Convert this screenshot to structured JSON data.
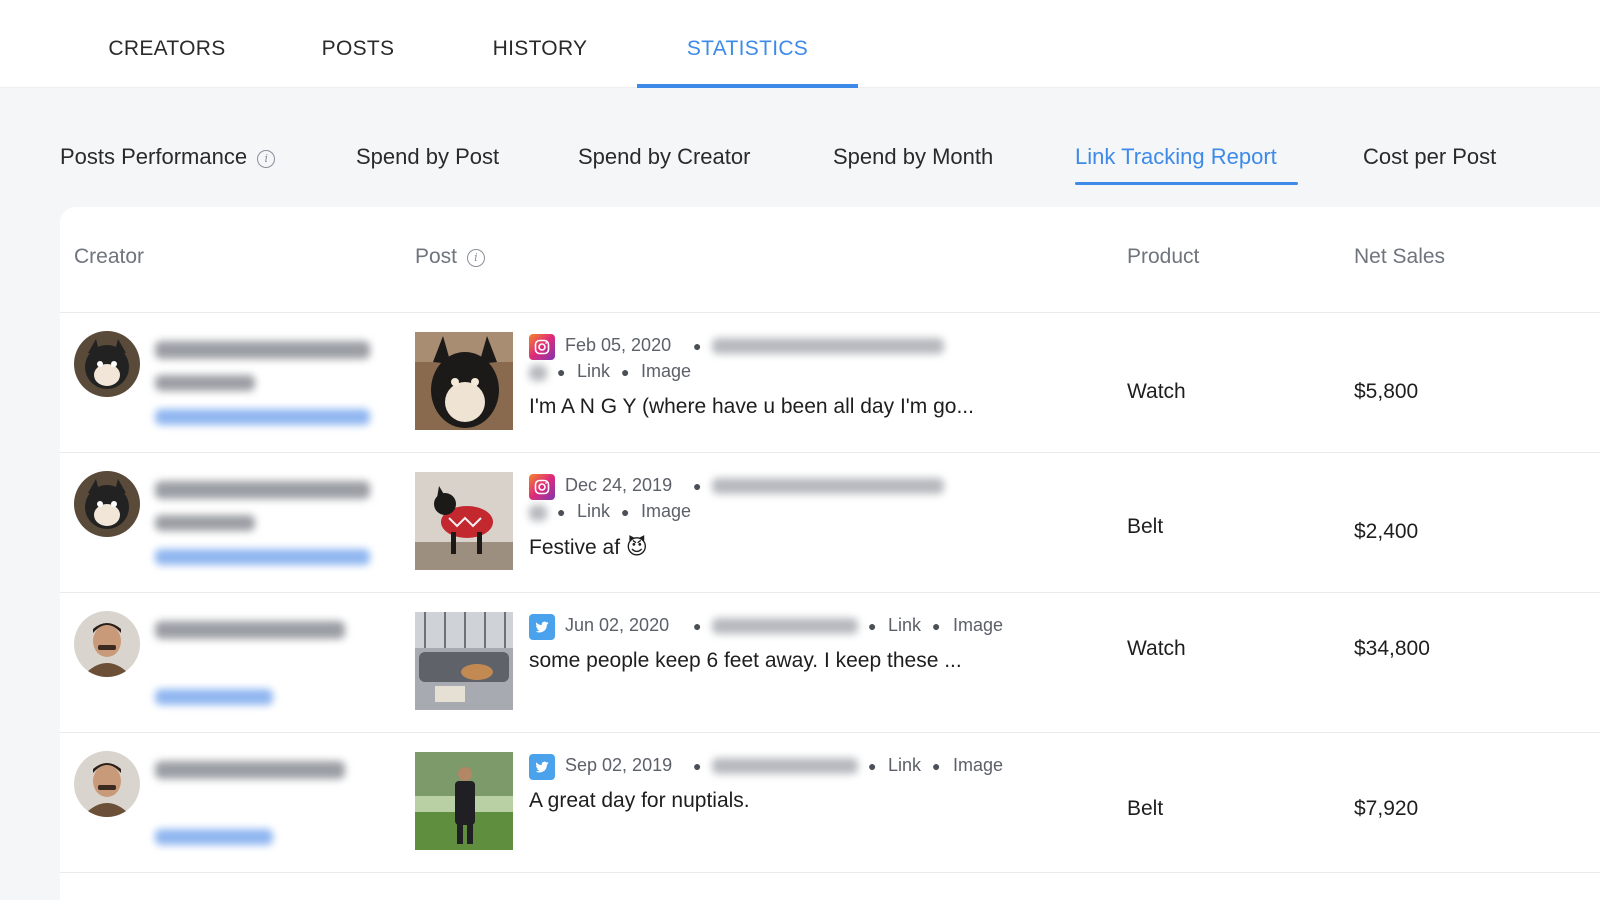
{
  "topnav": {
    "tabs": [
      {
        "label": "CREATORS"
      },
      {
        "label": "POSTS"
      },
      {
        "label": "HISTORY"
      },
      {
        "label": "STATISTICS"
      }
    ],
    "active": "STATISTICS"
  },
  "subtabs": {
    "items": [
      {
        "label": "Posts Performance"
      },
      {
        "label": "Spend by Post"
      },
      {
        "label": "Spend by Creator"
      },
      {
        "label": "Spend by Month"
      },
      {
        "label": "Link Tracking Report"
      },
      {
        "label": "Cost per Post"
      }
    ],
    "active": "Link Tracking Report"
  },
  "table": {
    "headers": {
      "creator": "Creator",
      "post": "Post",
      "product": "Product",
      "net_sales": "Net Sales"
    },
    "rows": [
      {
        "platform": "instagram-icon",
        "date": "Feb 05, 2020",
        "link_label": "Link",
        "media_label": "Image",
        "caption": "I'm A N G Y (where have u been all day I'm go...",
        "product": "Watch",
        "net_sales": "$5,800"
      },
      {
        "platform": "instagram-icon",
        "date": "Dec 24, 2019",
        "link_label": "Link",
        "media_label": "Image",
        "caption": "Festive af 😈",
        "product": "Belt",
        "net_sales": "$2,400"
      },
      {
        "platform": "twitter-icon",
        "date": "Jun 02, 2020",
        "link_label": "Link",
        "media_label": "Image",
        "caption": "some people keep 6 feet away. I keep these ...",
        "product": "Watch",
        "net_sales": "$34,800"
      },
      {
        "platform": "twitter-icon",
        "date": "Sep 02, 2019",
        "link_label": "Link",
        "media_label": "Image",
        "caption": "A great day for nuptials.",
        "product": "Belt",
        "net_sales": "$7,920"
      }
    ]
  },
  "colors": {
    "accent": "#3d8ae8",
    "instagram": "#e1306c",
    "twitter": "#4aa1ec"
  }
}
